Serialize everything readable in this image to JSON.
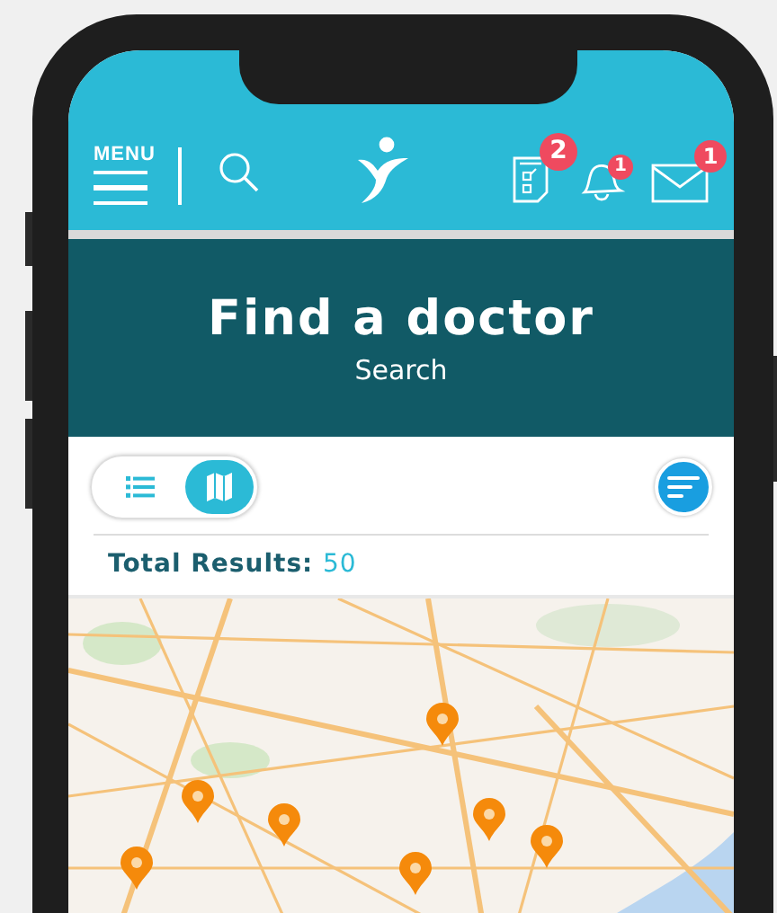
{
  "header": {
    "menu_label": "MENU",
    "actions": [
      {
        "kind": "tasks",
        "badge": "2"
      },
      {
        "kind": "bell",
        "badge": "1"
      },
      {
        "kind": "mail",
        "badge": "1"
      }
    ]
  },
  "banner": {
    "title": "Find a doctor",
    "subtitle": "Search"
  },
  "view_toggle": [
    {
      "kind": "list",
      "selected": false
    },
    {
      "kind": "map",
      "selected": true
    }
  ],
  "results": {
    "label": "Total Results:",
    "count": "50"
  }
}
